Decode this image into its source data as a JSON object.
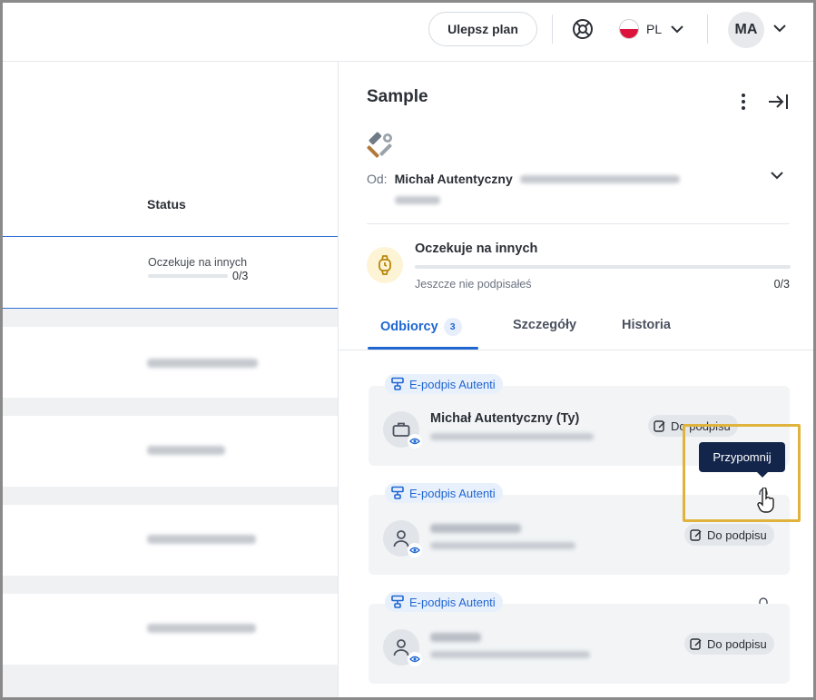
{
  "topbar": {
    "upgrade_label": "Ulepsz plan",
    "language": "PL",
    "avatar_initials": "MA"
  },
  "list": {
    "status_header": "Status",
    "selected_row": {
      "status": "Oczekuje na innych",
      "count": "0/3"
    }
  },
  "panel": {
    "title": "Sample",
    "from_label": "Od:",
    "from_name": "Michał Autentyczny",
    "status_title": "Oczekuje na innych",
    "status_sub": "Jeszcze nie podpisałeś",
    "status_count": "0/3",
    "status_progress": 0,
    "tabs": [
      {
        "label": "Odbiorcy",
        "badge": "3"
      },
      {
        "label": "Szczegóły"
      },
      {
        "label": "Historia"
      }
    ],
    "recipients": [
      {
        "method": "E-podpis Autenti",
        "name": "Michał Autentyczny (Ty)",
        "action": "Do podpisu"
      },
      {
        "method": "E-podpis Autenti",
        "action": "Do podpisu"
      },
      {
        "method": "E-podpis Autenti",
        "action": "Do podpisu"
      }
    ],
    "tooltip": "Przypomnij"
  },
  "icons": {
    "help": "lifebuoy-icon",
    "chevron": "chevron-down-icon",
    "kebab": "kebab-menu-icon",
    "collapse": "collapse-panel-icon",
    "tools": "hammer-wrench-icon",
    "watch": "watch-icon",
    "briefcase": "briefcase-icon",
    "person": "person-icon",
    "eye": "eye-icon",
    "edit": "edit-icon",
    "bell": "bell-icon",
    "signature": "signature-icon"
  },
  "colors": {
    "accent": "#1f66d1",
    "tooltip_bg": "#13254a",
    "highlight": "#e0b43c",
    "flag_red": "#dc143c"
  }
}
